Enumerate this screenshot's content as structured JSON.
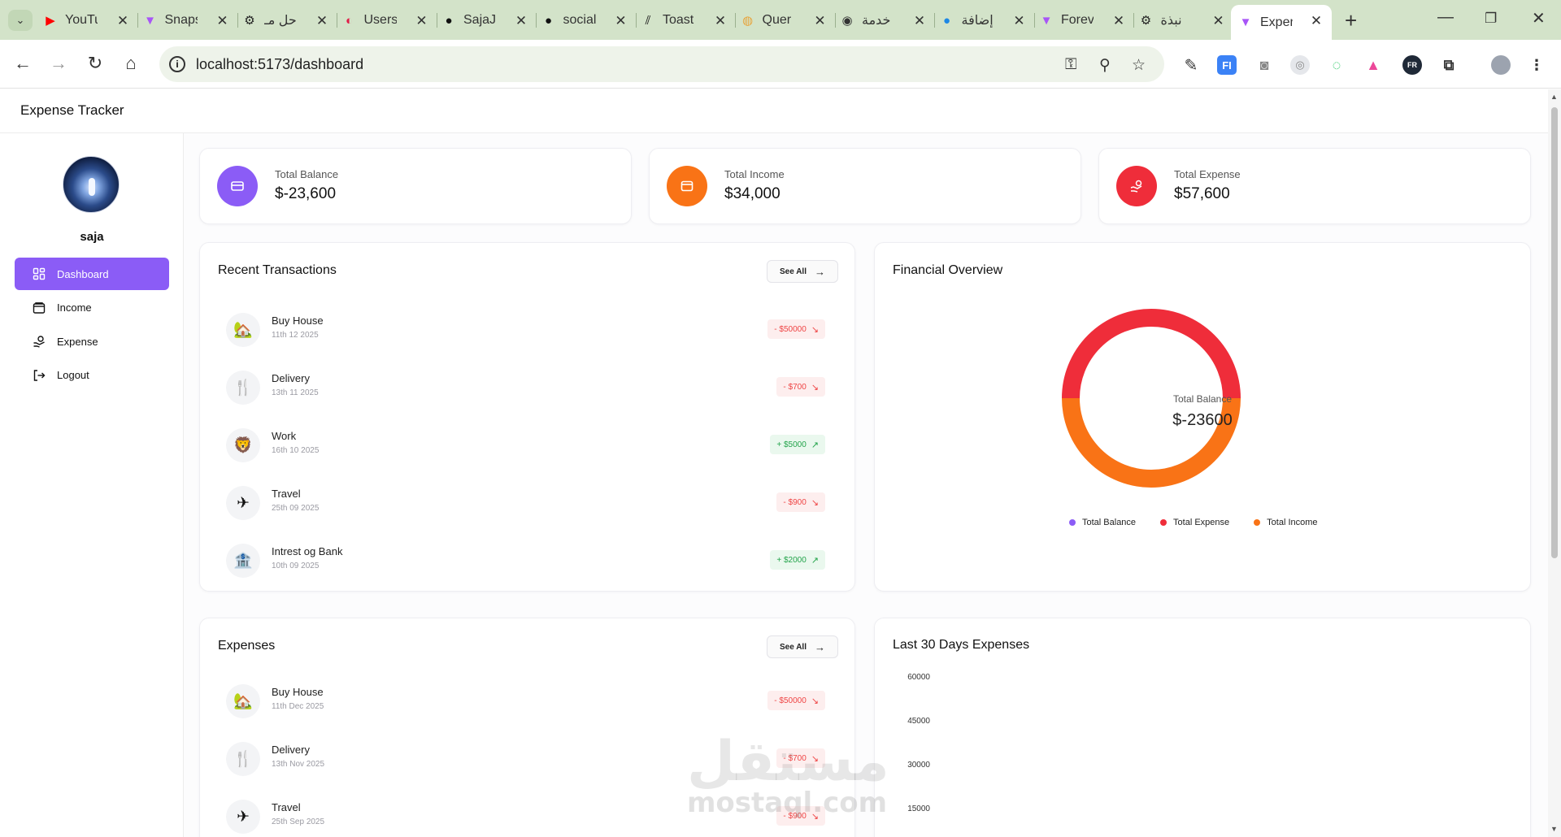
{
  "browser": {
    "tabs": [
      {
        "title": "YouTube",
        "icon": "youtube-icon",
        "color": "#ff0000"
      },
      {
        "title": "Snapshot",
        "icon": "vite-icon",
        "color": "#a855f7"
      },
      {
        "title": "حل مـ",
        "icon": "openai-icon",
        "color": "#222222"
      },
      {
        "title": "Users",
        "icon": "app-icon",
        "color": "#e11d48"
      },
      {
        "title": "SajaJ",
        "icon": "github-icon",
        "color": "#111111"
      },
      {
        "title": "social",
        "icon": "github-icon",
        "color": "#111111"
      },
      {
        "title": "Toast",
        "icon": "toast-icon",
        "color": "#111111"
      },
      {
        "title": "Quer",
        "icon": "query-icon",
        "color": "#e8a33a"
      },
      {
        "title": "خدمة",
        "icon": "globe-icon",
        "color": "#333333"
      },
      {
        "title": "إضافة",
        "icon": "blue-circle-icon",
        "color": "#1e88e5"
      },
      {
        "title": "Forev",
        "icon": "vite-icon",
        "color": "#a855f7"
      },
      {
        "title": "نبذة",
        "icon": "openai-icon",
        "color": "#222222"
      },
      {
        "title": "Expen",
        "icon": "vite-icon",
        "color": "#a855f7"
      }
    ],
    "url": "localhost:5173/dashboard"
  },
  "app": {
    "title": "Expense Tracker",
    "user": {
      "name": "saja"
    },
    "nav": [
      {
        "label": "Dashboard",
        "icon": "dashboard-icon",
        "active": true
      },
      {
        "label": "Income",
        "icon": "wallet-icon",
        "active": false
      },
      {
        "label": "Expense",
        "icon": "expense-icon",
        "active": false
      },
      {
        "label": "Logout",
        "icon": "logout-icon",
        "active": false
      }
    ],
    "stats": [
      {
        "label": "Total Balance",
        "value": "$-23,600",
        "color": "#8b5cf6",
        "icon": "card-icon"
      },
      {
        "label": "Total Income",
        "value": "$34,000",
        "color": "#f97316",
        "icon": "wallet-icon"
      },
      {
        "label": "Total Expense",
        "value": "$57,600",
        "color": "#ef2d3a",
        "icon": "hand-coins-icon"
      }
    ],
    "recent": {
      "title": "Recent Transactions",
      "see_all": "See All",
      "items": [
        {
          "name": "Buy House",
          "date": "11th 12 2025",
          "amount": "- $50000",
          "type": "neg",
          "icon": "🏡"
        },
        {
          "name": "Delivery",
          "date": "13th 11 2025",
          "amount": "- $700",
          "type": "neg",
          "icon": "🍴"
        },
        {
          "name": "Work",
          "date": "16th 10 2025",
          "amount": "+ $5000",
          "type": "pos",
          "icon": "🦁"
        },
        {
          "name": "Travel",
          "date": "25th 09 2025",
          "amount": "- $900",
          "type": "neg",
          "icon": "✈"
        },
        {
          "name": "Intrest og Bank",
          "date": "10th 09 2025",
          "amount": "+ $2000",
          "type": "pos",
          "icon": "🏦"
        }
      ]
    },
    "overview": {
      "title": "Financial Overview",
      "center_label": "Total Balance",
      "center_value": "$-23600",
      "legend": [
        {
          "label": "Total Balance",
          "color": "#8b5cf6"
        },
        {
          "label": "Total Expense",
          "color": "#ef2d3a"
        },
        {
          "label": "Total Income",
          "color": "#f97316"
        }
      ]
    },
    "expenses": {
      "title": "Expenses",
      "see_all": "See All",
      "items": [
        {
          "name": "Buy House",
          "date": "11th Dec 2025",
          "amount": "- $50000",
          "type": "neg",
          "icon": "🏡"
        },
        {
          "name": "Delivery",
          "date": "13th Nov 2025",
          "amount": "- $700",
          "type": "neg",
          "icon": "🍴"
        },
        {
          "name": "Travel",
          "date": "25th Sep 2025",
          "amount": "- $900",
          "type": "neg",
          "icon": "✈"
        }
      ]
    },
    "last30": {
      "title": "Last 30 Days Expenses",
      "yticks": [
        "60000",
        "45000",
        "30000",
        "15000"
      ]
    }
  },
  "watermark": {
    "arabic": "مستقل",
    "latin": "mostaql.com"
  }
}
